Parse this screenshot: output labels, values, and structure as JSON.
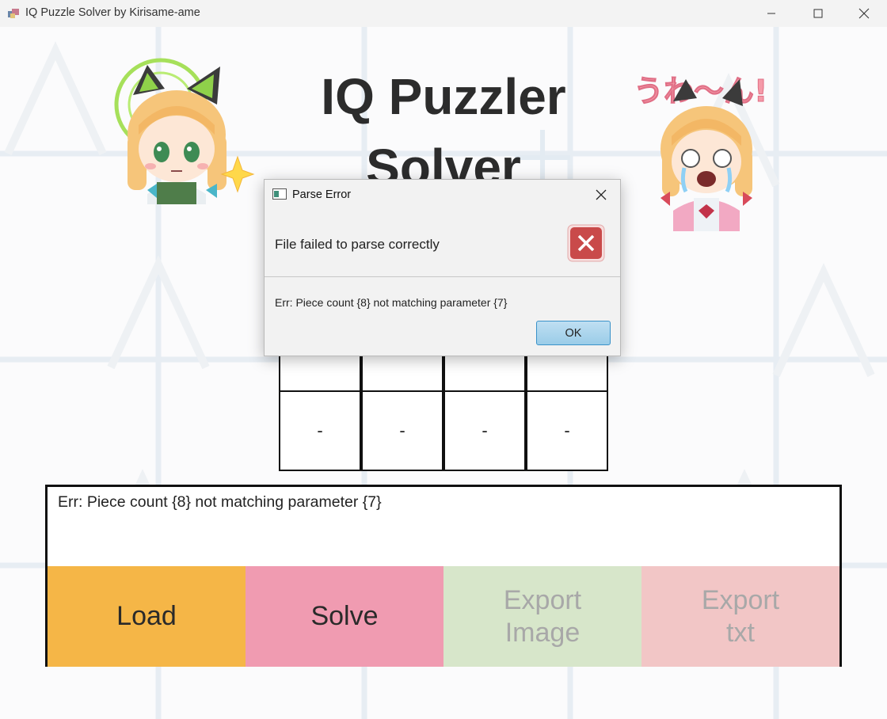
{
  "window": {
    "title": "IQ Puzzle Solver by Kirisame-ame",
    "controls": [
      "minimize",
      "maximize",
      "close"
    ]
  },
  "header": {
    "title_line1": "IQ Puzzler",
    "title_line2": "Solver"
  },
  "characters": {
    "left_icon": "cat-ear-chibi-icon",
    "right_icon": "crying-chibi-icon",
    "right_sticker_text": "うわ〜ん!"
  },
  "grid": {
    "rows": [
      [
        "",
        "",
        "",
        ""
      ],
      [
        "-",
        "-",
        "-",
        "-"
      ]
    ]
  },
  "log": {
    "text": "Err: Piece count {8} not matching parameter {7}"
  },
  "buttons": {
    "load": "Load",
    "solve": "Solve",
    "export_image_1": "Export",
    "export_image_2": "Image",
    "export_txt_1": "Export",
    "export_txt_2": "txt"
  },
  "dialog": {
    "title": "Parse Error",
    "header": "File failed to parse correctly",
    "content": "Err: Piece count {8} not matching parameter {7}",
    "ok_label": "OK",
    "icon": "error-icon"
  },
  "colors": {
    "load": "#f5b647",
    "solve": "#f09bb1",
    "export_image": "#d7e6ca",
    "export_txt": "#f2c6c6",
    "ok_button": "#9acce8"
  }
}
